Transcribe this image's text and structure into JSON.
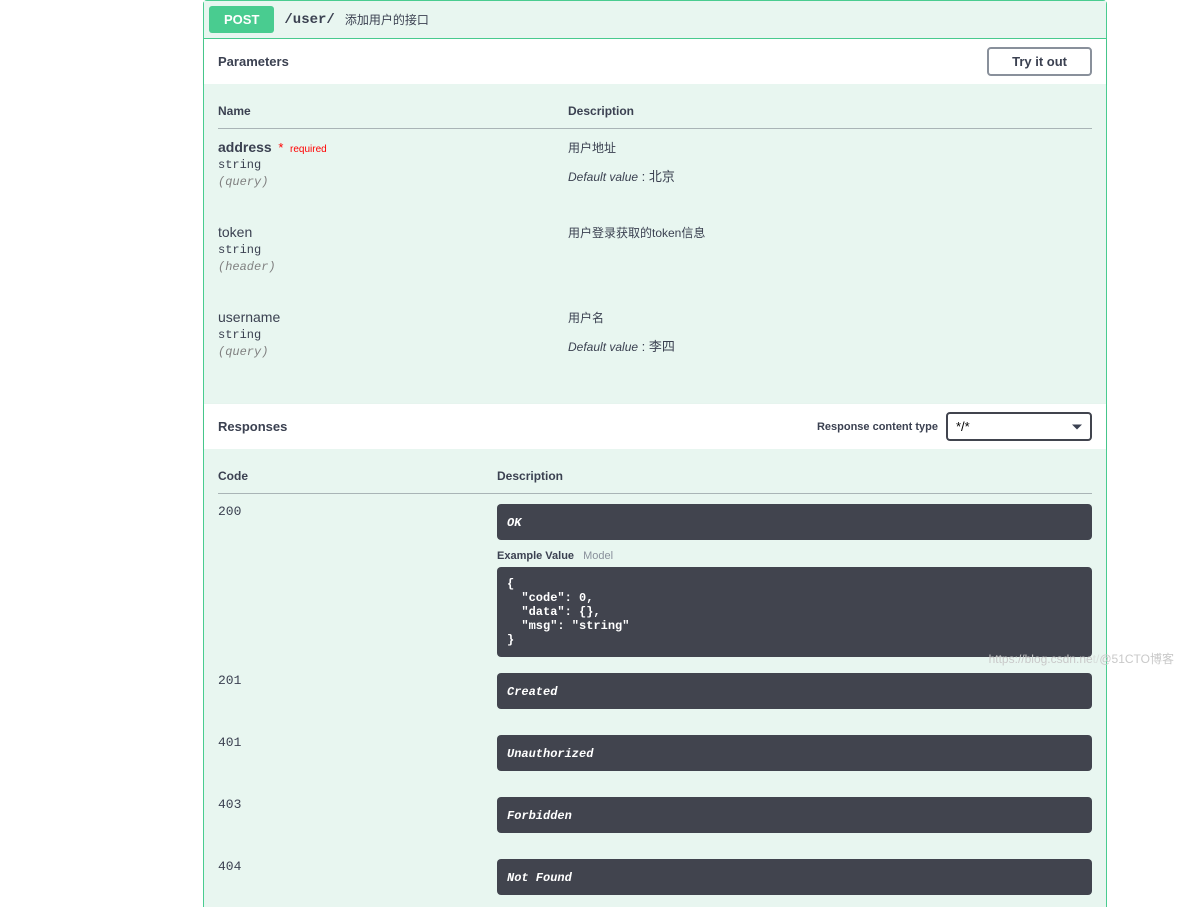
{
  "operation": {
    "method": "POST",
    "path": "/user/",
    "summary": "添加用户的接口"
  },
  "sections": {
    "parameters_title": "Parameters",
    "try_it_out": "Try it out",
    "responses_title": "Responses",
    "content_type_label": "Response content type",
    "content_type_value": "*/*"
  },
  "param_headers": {
    "name": "Name",
    "description": "Description"
  },
  "parameters": [
    {
      "name": "address",
      "required": true,
      "required_label": "required",
      "type": "string",
      "in": "(query)",
      "description": "用户地址",
      "default_label": "Default value",
      "default_value": "北京"
    },
    {
      "name": "token",
      "required": false,
      "type": "string",
      "in": "(header)",
      "description": "用户登录获取的token信息"
    },
    {
      "name": "username",
      "required": false,
      "type": "string",
      "in": "(query)",
      "description": "用户名",
      "default_label": "Default value",
      "default_value": "李四"
    }
  ],
  "response_headers": {
    "code": "Code",
    "description": "Description"
  },
  "example_tabs": {
    "active": "Example Value",
    "inactive": "Model"
  },
  "example_body": "{\n  \"code\": 0,\n  \"data\": {},\n  \"msg\": \"string\"\n}",
  "responses": [
    {
      "code": "200",
      "desc": "OK",
      "has_example": true
    },
    {
      "code": "201",
      "desc": "Created"
    },
    {
      "code": "401",
      "desc": "Unauthorized"
    },
    {
      "code": "403",
      "desc": "Forbidden"
    },
    {
      "code": "404",
      "desc": "Not Found"
    }
  ],
  "watermark": {
    "left": "https://blog.csdn.ne",
    "right": "@51CTO博客"
  }
}
